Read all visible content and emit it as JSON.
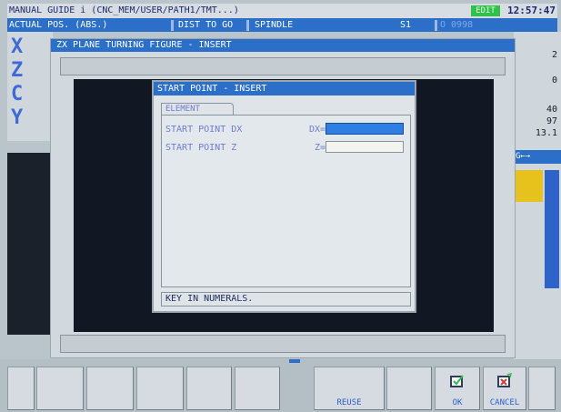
{
  "title_bar": {
    "title": "MANUAL GUIDE i (CNC_MEM/USER/PATH1/TMT...)",
    "mode": "EDIT",
    "clock": "12:57:47"
  },
  "position_tabs": {
    "actual": "ACTUAL POS. (ABS.)",
    "dist": "DIST TO GO",
    "spindle": "SPINDLE",
    "s1": "S1",
    "program": "O 0998"
  },
  "axes": [
    "X",
    "Z",
    "C",
    "Y"
  ],
  "right_panel": {
    "values": [
      "2",
      "0",
      "40",
      "97",
      "13.1"
    ],
    "g_label": "G←→"
  },
  "background_window": {
    "title": "ZX PLANE TURNING FIGURE - INSERT"
  },
  "dialog": {
    "title": "START POINT - INSERT",
    "tab": "ELEMENT",
    "fields": [
      {
        "label": "START POINT DX",
        "eq": "DX=",
        "value": ""
      },
      {
        "label": "START POINT Z",
        "eq": "Z=",
        "value": ""
      }
    ],
    "message": "KEY IN NUMERALS."
  },
  "softkeys": [
    {
      "label": ""
    },
    {
      "label": ""
    },
    {
      "label": ""
    },
    {
      "label": ""
    },
    {
      "label": ""
    },
    {
      "label": ""
    },
    {
      "label": "REUSE"
    },
    {
      "label": ""
    },
    {
      "label": "OK"
    },
    {
      "label": "CANCEL"
    },
    {
      "label": ""
    }
  ],
  "colors": {
    "accent_blue": "#2c6fc9",
    "edit_green": "#2fc14a",
    "active_field": "#2f7ee3"
  }
}
